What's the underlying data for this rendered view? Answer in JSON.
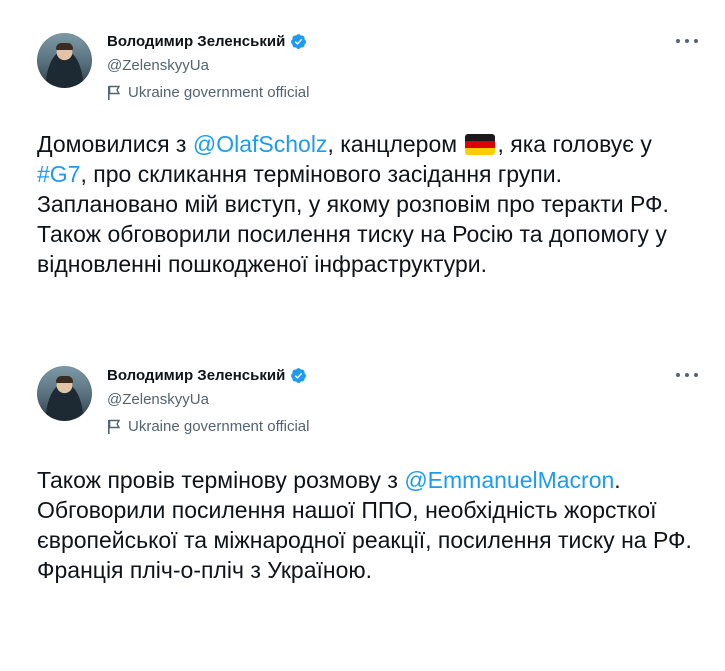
{
  "tweets": [
    {
      "author": {
        "name": "Володимир Зеленський",
        "handle": "@ZelenskyyUa",
        "label": "Ukraine government official"
      },
      "text": {
        "p1": "Домовилися з ",
        "mention": "@OlafScholz",
        "p2": ", канцлером ",
        "flag": "🇩🇪",
        "p3": ", яка головує у ",
        "hashtag": "#G7",
        "p4": ", про скликання термінового засідання групи. Заплановано мій виступ, у якому розповім про теракти РФ. Також обговорили посилення тиску на Росію та допомогу у відновленні пошкодженої інфраструктури."
      }
    },
    {
      "author": {
        "name": "Володимир Зеленський",
        "handle": "@ZelenskyyUa",
        "label": "Ukraine government official"
      },
      "text": {
        "p1": "Також провів термінову розмову з ",
        "mention": "@EmmanuelMacron",
        "p2": ". Обговорили посилення нашої ППО, необхідність жорсткої європейської та міжнародної реакції, посилення тиску на РФ. Франція пліч-о-пліч з Україною."
      }
    }
  ],
  "colors": {
    "accent": "#1d9bf0",
    "text": "#0f1419",
    "secondary": "#536471"
  },
  "icons": {
    "verified": "verified-badge-icon",
    "label": "flag-icon",
    "more": "more-icon"
  }
}
